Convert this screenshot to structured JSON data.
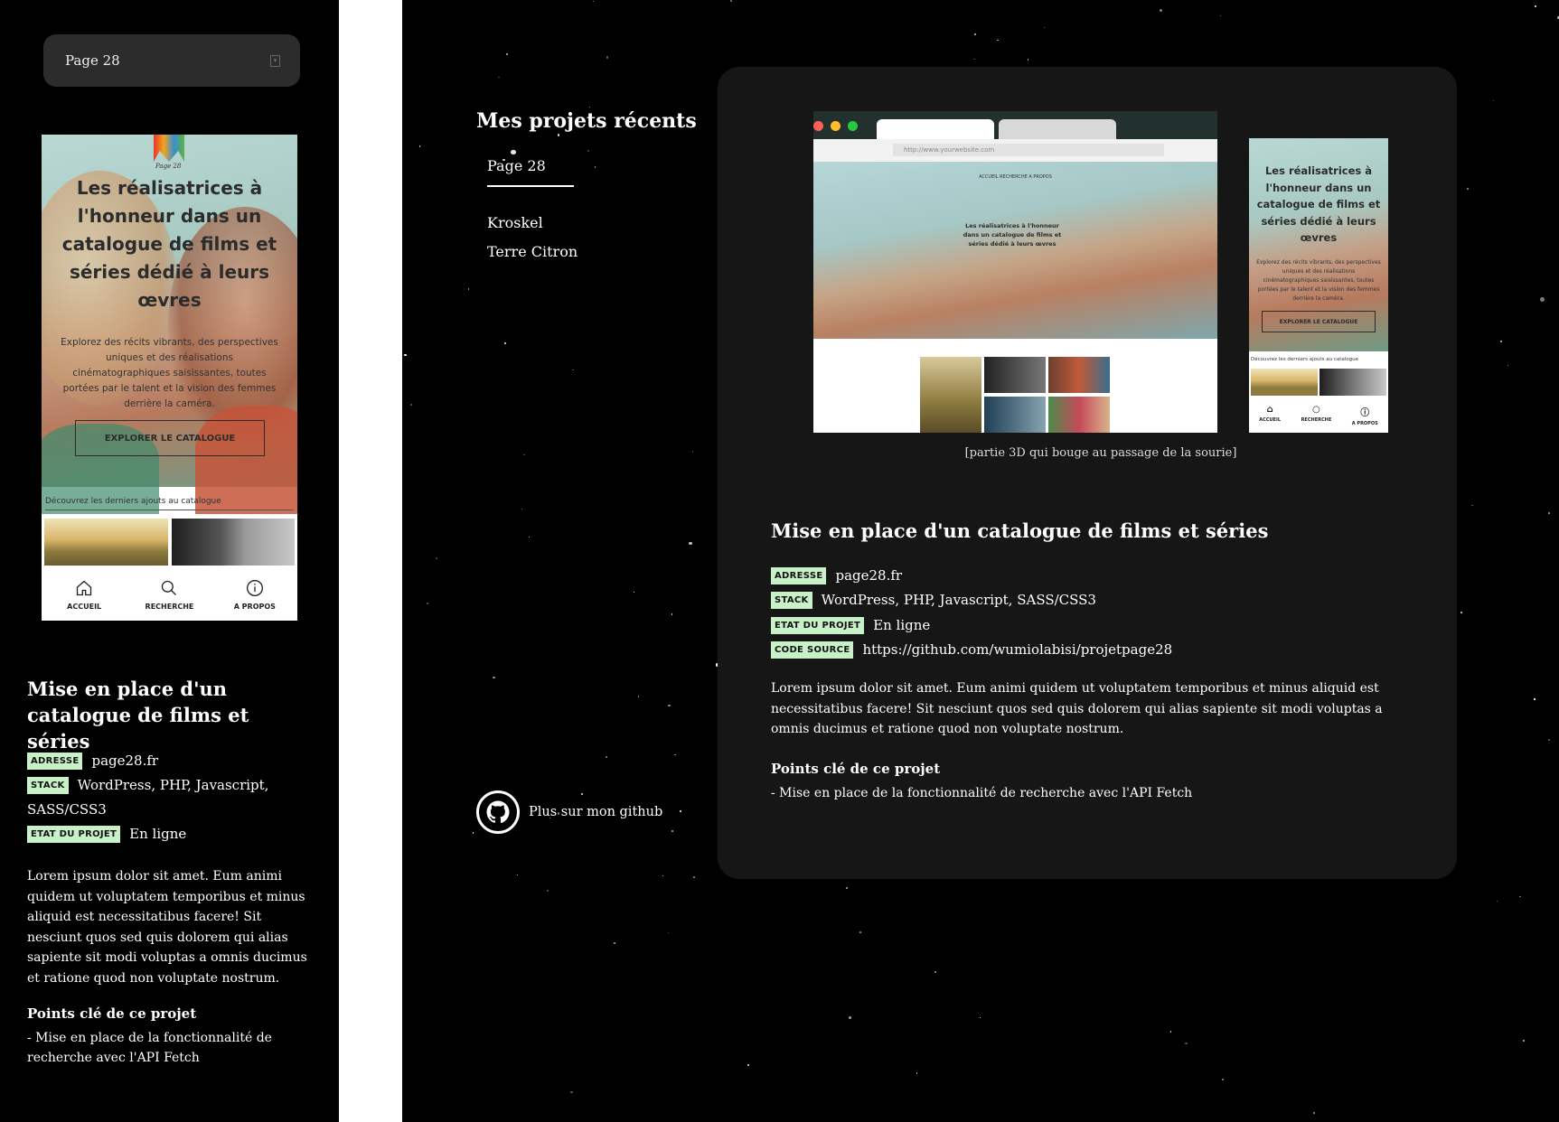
{
  "selector": {
    "value": "Page 28"
  },
  "mobile_preview": {
    "logo_text": "Page 28",
    "hero_title": "Les réalisatrices à l'honneur dans un catalogue de films et séries dédié à leurs œvres",
    "hero_desc": "Explorez des récits vibrants, des perspectives uniques et des réalisations cinématographiques saisissantes, toutes portées par le talent et la vision des femmes derrière la caméra.",
    "cta": "EXPLORER LE CATALOGUE",
    "latest_label": "Découvrez les derniers ajouts au catalogue",
    "tabs": [
      {
        "label": "ACCUEIL",
        "icon": "home-icon"
      },
      {
        "label": "RECHERCHE",
        "icon": "search-icon"
      },
      {
        "label": "A PROPOS",
        "icon": "info-icon"
      }
    ]
  },
  "project": {
    "title": "Mise en place d'un catalogue de films et séries",
    "info": [
      {
        "tag": "ADRESSE",
        "value": "page28.fr"
      },
      {
        "tag": "STACK",
        "value": "WordPress, PHP, Javascript, SASS/CSS3"
      },
      {
        "tag": "ETAT DU PROJET",
        "value": "En ligne"
      },
      {
        "tag": "CODE SOURCE",
        "value": "https://github.com/wumiolabisi/projetpage28"
      }
    ],
    "description": "Lorem ipsum dolor sit amet. Eum animi quidem ut voluptatem temporibus et minus aliquid est necessitatibus facere! Sit nesciunt quos sed quis dolorem qui alias sapiente sit modi voluptas a omnis ducimus et ratione quod non voluptate nostrum.",
    "points_title": "Points clé de ce projet",
    "points": "- Mise en place de la fonctionnalité de recherche avec l'API Fetch"
  },
  "sidebar": {
    "title": "Mes projets récents",
    "items": [
      {
        "label": "Page 28",
        "active": true
      },
      {
        "label": "Kroskel"
      },
      {
        "label": "Terre Citron"
      }
    ],
    "github_label": "Plus sur mon github"
  },
  "preview": {
    "browser_url": "http://www.yourwebsite.com",
    "browser_nav": "ACCUEIL   RECHERCHE   A PROPOS",
    "browser_hero_title": "Les réalisatrices à l'honneur dans un catalogue de films et séries dédié à leurs œvres",
    "caption": "[partie 3D qui bouge au passage de la sourie]"
  },
  "colors": {
    "background": "#000000",
    "card": "#161616",
    "tag_bg": "#c8f1c8",
    "gutter": "#ffffff"
  }
}
